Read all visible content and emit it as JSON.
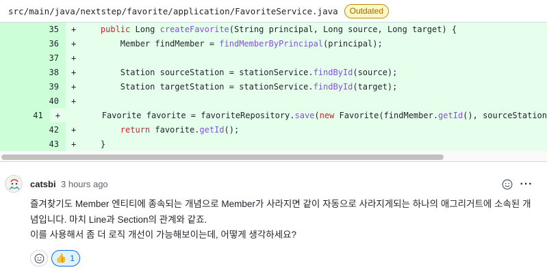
{
  "file": {
    "path": "src/main/java/nextstep/favorite/application/FavoriteService.java",
    "badge": "Outdated"
  },
  "diff": {
    "marker": "+",
    "lines": [
      {
        "num": "35",
        "segments": [
          {
            "t": "    ",
            "c": "code"
          },
          {
            "t": "public",
            "c": "kw"
          },
          {
            "t": " Long ",
            "c": "code"
          },
          {
            "t": "createFavorite",
            "c": "fn"
          },
          {
            "t": "(String principal, Long source, Long target) {",
            "c": "code"
          }
        ]
      },
      {
        "num": "36",
        "segments": [
          {
            "t": "        Member findMember = ",
            "c": "code"
          },
          {
            "t": "findMemberByPrincipal",
            "c": "fn"
          },
          {
            "t": "(principal);",
            "c": "code"
          }
        ]
      },
      {
        "num": "37",
        "segments": [
          {
            "t": "",
            "c": "code"
          }
        ]
      },
      {
        "num": "38",
        "segments": [
          {
            "t": "        Station sourceStation = stationService.",
            "c": "code"
          },
          {
            "t": "findById",
            "c": "fn"
          },
          {
            "t": "(source);",
            "c": "code"
          }
        ]
      },
      {
        "num": "39",
        "segments": [
          {
            "t": "        Station targetStation = stationService.",
            "c": "code"
          },
          {
            "t": "findById",
            "c": "fn"
          },
          {
            "t": "(target);",
            "c": "code"
          }
        ]
      },
      {
        "num": "40",
        "segments": [
          {
            "t": "",
            "c": "code"
          }
        ]
      },
      {
        "num": "41",
        "segments": [
          {
            "t": "        Favorite favorite = favoriteRepository.",
            "c": "code"
          },
          {
            "t": "save",
            "c": "fn"
          },
          {
            "t": "(",
            "c": "code"
          },
          {
            "t": "new",
            "c": "kw"
          },
          {
            "t": " Favorite(findMember.",
            "c": "code"
          },
          {
            "t": "getId",
            "c": "fn"
          },
          {
            "t": "(), sourceStation",
            "c": "code"
          }
        ]
      },
      {
        "num": "42",
        "segments": [
          {
            "t": "        ",
            "c": "code"
          },
          {
            "t": "return",
            "c": "kw"
          },
          {
            "t": " favorite.",
            "c": "code"
          },
          {
            "t": "getId",
            "c": "fn"
          },
          {
            "t": "();",
            "c": "code"
          }
        ]
      },
      {
        "num": "43",
        "segments": [
          {
            "t": "    }",
            "c": "code"
          }
        ]
      }
    ]
  },
  "comment": {
    "author": "catsbi",
    "time": "3 hours ago",
    "body_lines": [
      "즐겨찾기도 Member 엔티티에 종속되는 개념으로 Member가 사라지면 같이 자동으로 사라지게되는 하나의 애그리거트에 소속된 개",
      "념입니다. 마치 Line과 Section의 관계와 같죠.",
      "이를 사용해서 좀 더 로직 개선이 가능해보이는데, 어떻게 생각하세요?"
    ],
    "menu_label": "···",
    "reaction": {
      "emoji": "👍",
      "count": "1"
    }
  },
  "colors": {
    "added_bg": "#e6ffec",
    "added_gutter": "#ccffd8",
    "keyword": "#cf222e",
    "function": "#8250df",
    "badge_border": "#bf8700",
    "reaction_border": "#0969da"
  }
}
